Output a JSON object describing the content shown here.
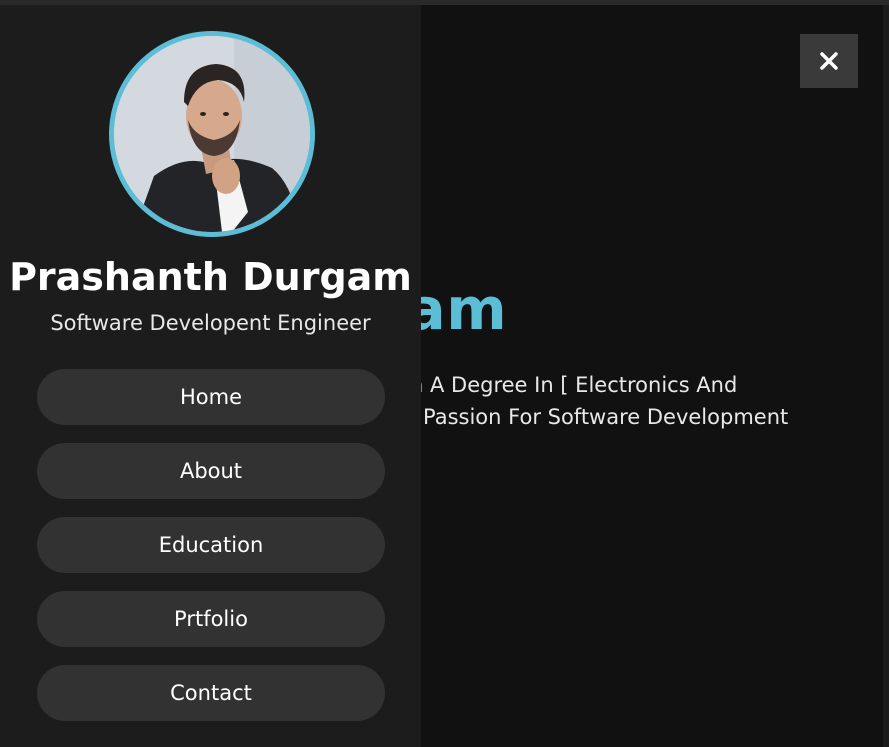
{
  "hero": {
    "name_visible": "Durgam",
    "desc_line1": "n A Degree In [ Electronics And",
    "desc_line2": "Passion For Software Development"
  },
  "close_button": {
    "icon": "close-icon"
  },
  "sidebar": {
    "avatar_icon": "person-photo",
    "name": "Prashanth Durgam",
    "role": "Software Developent Engineer",
    "nav": [
      {
        "label": "Home"
      },
      {
        "label": "About"
      },
      {
        "label": "Education"
      },
      {
        "label": "Prtfolio"
      },
      {
        "label": "Contact"
      }
    ]
  },
  "colors": {
    "accent": "#5bbdd6",
    "background": "#111111",
    "sidebar": "#1c1c1c",
    "nav_button": "#323232",
    "close_button": "#3a3a3a"
  }
}
